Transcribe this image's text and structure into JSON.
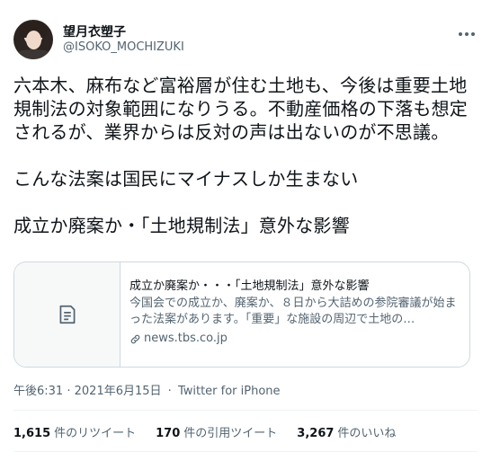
{
  "author": {
    "display_name": "望月衣塑子",
    "handle": "@ISOKO_MOCHIZUKI"
  },
  "tweet": {
    "text": "六本木、麻布など富裕層が住む土地も、今後は重要土地規制法の対象範囲になりうる。不動産価格の下落も想定されるが、業界からは反対の声は出ないのが不思議。\n\nこんな法案は国民にマイナスしか生まない\n\n成立か廃案か・「土地規制法」意外な影響"
  },
  "link_card": {
    "title": "成立か廃案か・・・「土地規制法」意外な影響",
    "description": "今国会での成立か、廃案か、８日から大詰めの参院審議が始まった法案があります。「重要」な施設の周辺で土地の…",
    "domain": "news.tbs.co.jp",
    "thumb_icon": "document-icon",
    "domain_icon": "link-icon"
  },
  "meta": {
    "time": "午後6:31",
    "date": "2021年6月15日",
    "separator": "·",
    "source": "Twitter for iPhone"
  },
  "stats": {
    "retweets_count": "1,615",
    "retweets_label": "件のリツイート",
    "quotes_count": "170",
    "quotes_label": "件の引用ツイート",
    "likes_count": "3,267",
    "likes_label": "件のいいね"
  },
  "colors": {
    "text_primary": "#0f1419",
    "text_secondary": "#536471",
    "border": "#cfd9de"
  }
}
